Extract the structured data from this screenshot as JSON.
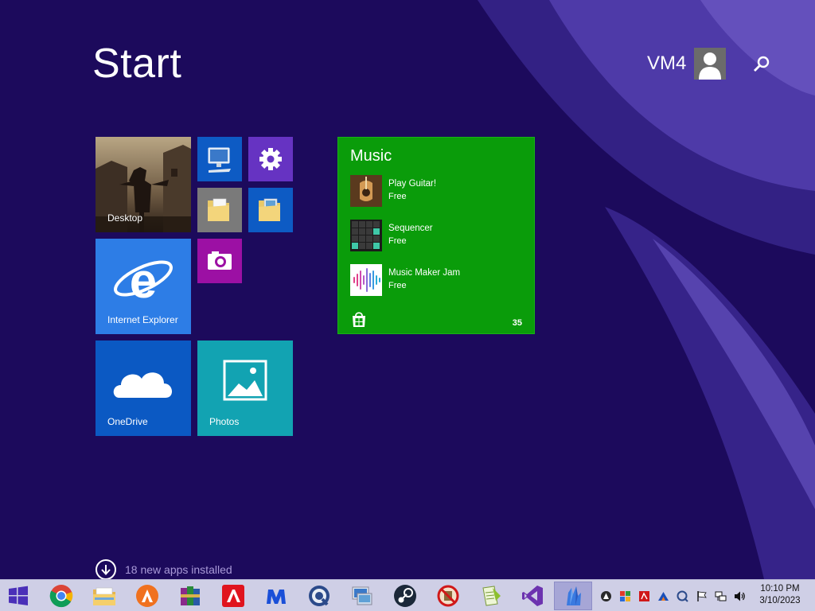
{
  "start": {
    "title": "Start",
    "user_name": "VM4"
  },
  "tiles": {
    "desktop": "Desktop",
    "internet_explorer": "Internet Explorer",
    "onedrive": "OneDrive",
    "photos": "Photos"
  },
  "music_tile": {
    "title": "Music",
    "items": [
      {
        "name": "Play Guitar!",
        "price": "Free"
      },
      {
        "name": "Sequencer",
        "price": "Free"
      },
      {
        "name": "Music Maker Jam",
        "price": "Free"
      }
    ],
    "count": "35"
  },
  "footer": {
    "new_apps": "18 new apps installed"
  },
  "taskbar": {
    "apps": [
      "start-icon",
      "chrome-icon",
      "file-explorer-icon",
      "avast-icon",
      "winrar-icon",
      "avira-icon",
      "malwarebytes-icon",
      "quicktime-icon",
      "remote-desktop-icon",
      "steam-icon",
      "no-symbol-icon",
      "notepad-plus-icon",
      "visual-studio-icon",
      "crystal-icon"
    ],
    "tray": [
      "avast-tray-icon",
      "color-grid-tray-icon",
      "pdf-tray-icon",
      "up-arrow-tray-icon",
      "quicktime-tray-icon",
      "flag-icon",
      "network-icon",
      "volume-icon"
    ],
    "time": "10:10 PM",
    "date": "3/10/2023"
  },
  "colors": {
    "background": "#1c0a5c",
    "music_tile": "#0a9c0a",
    "ie_tile": "#2d7de6",
    "onedrive_tile": "#0b59c3",
    "photos_tile": "#12a3b2",
    "settings_tile": "#6633c2",
    "camera_tile": "#9c10a4",
    "taskbar": "#cfcfe6"
  }
}
